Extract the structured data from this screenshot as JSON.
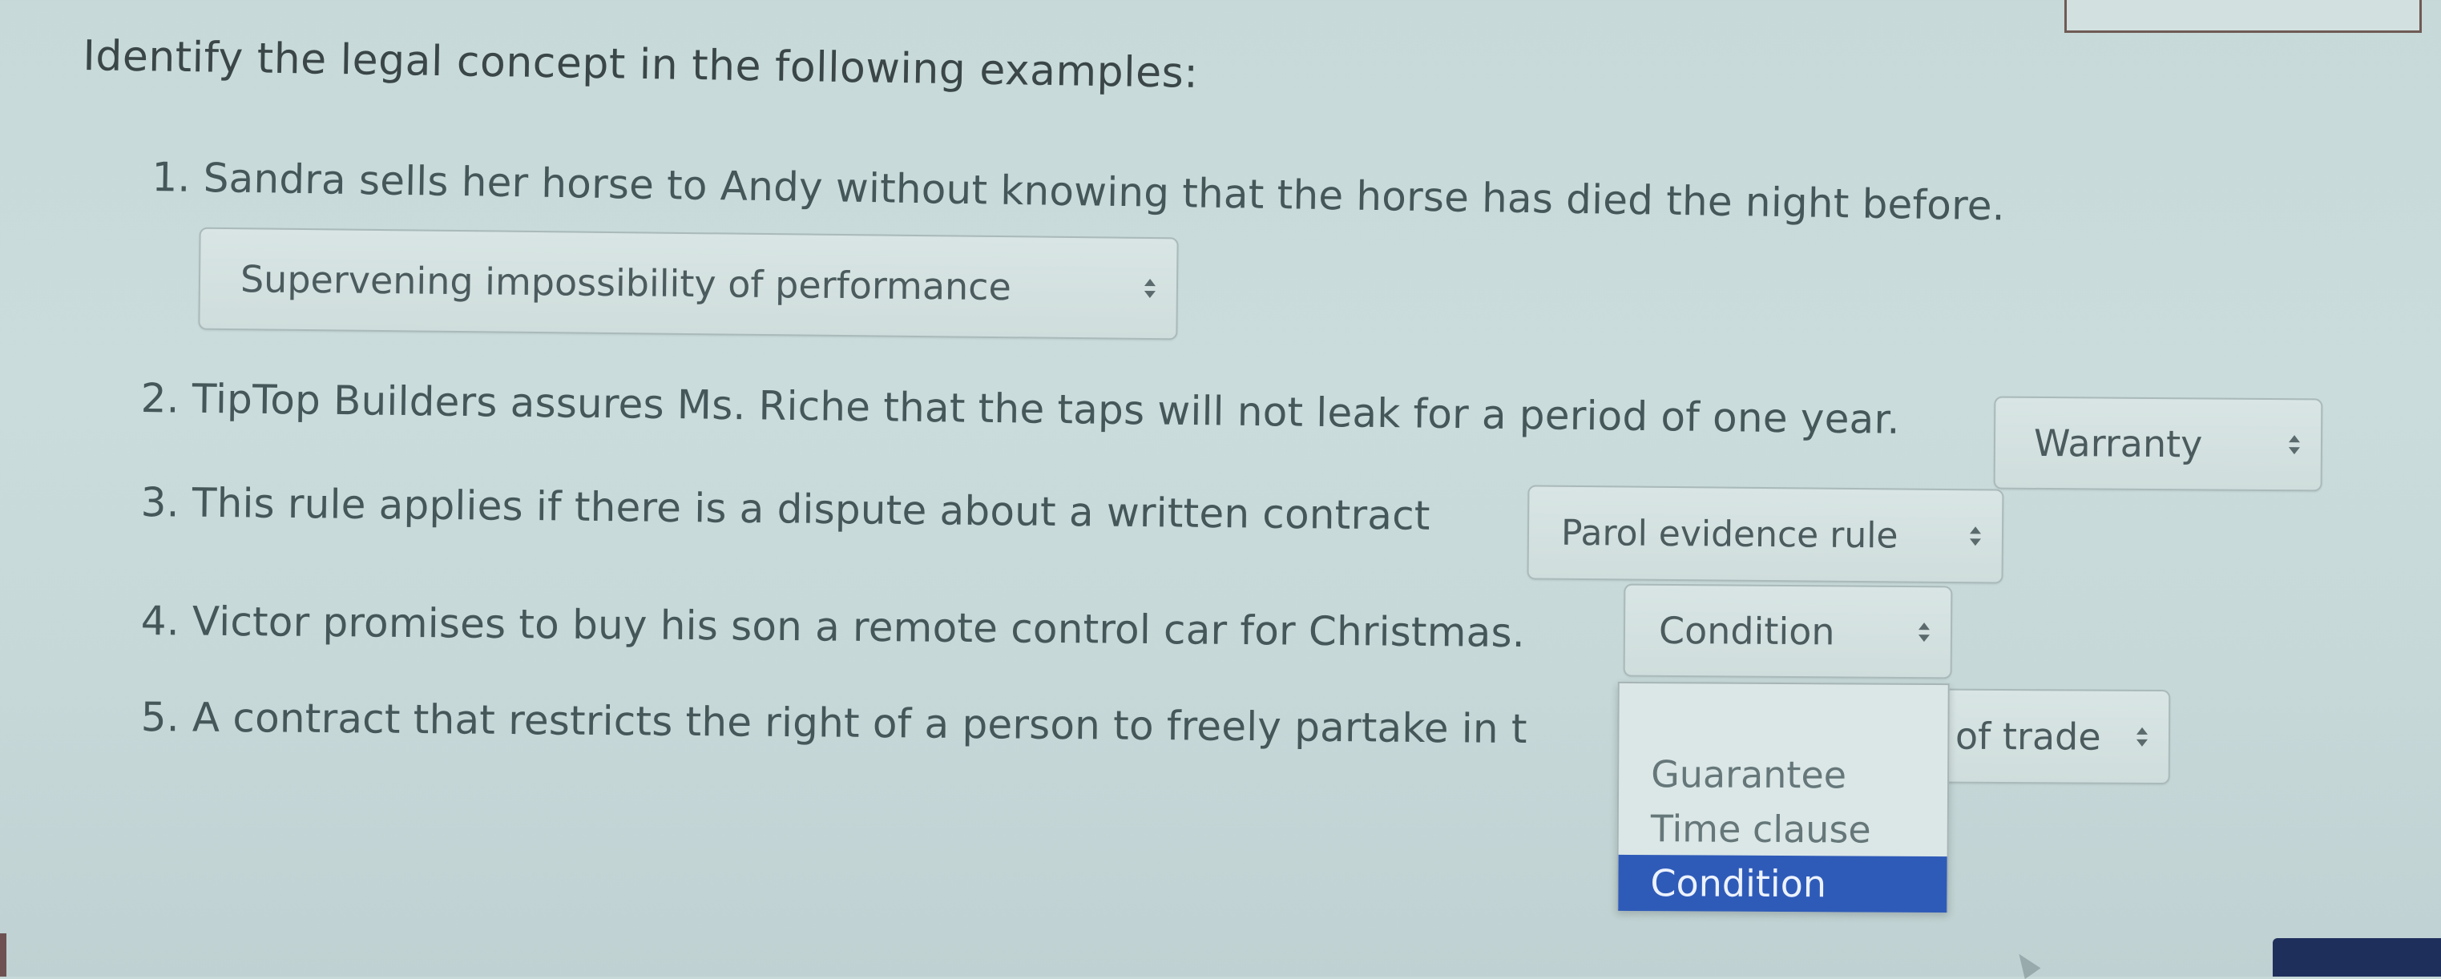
{
  "heading": "Identify the legal concept in the following examples:",
  "questions": [
    {
      "text": "1. Sandra sells her horse to Andy without knowing that the horse has died the night before.",
      "selected": "Supervening impossibility of performance"
    },
    {
      "text": "2. TipTop Builders assures Ms. Riche that the taps will not leak for a period of one year.",
      "selected": "Warranty"
    },
    {
      "text": "3. This rule applies if there is a dispute about a written contract",
      "selected": "Parol evidence rule"
    },
    {
      "text": "4. Victor promises to buy his son a remote control car for Christmas.",
      "selected": "Condition"
    },
    {
      "text": "5. A contract that restricts the right of a person to freely partake in t",
      "selected": "of trade"
    }
  ],
  "dropdown": {
    "options": [
      "Guarantee",
      "Time clause",
      "Condition"
    ],
    "highlighted": "Condition"
  },
  "colors": {
    "background": "#c9dbdb",
    "highlight": "#2f5bb8",
    "text": "#46575a"
  },
  "icons": [
    "select-arrows-icon",
    "mouse-cursor-icon"
  ]
}
